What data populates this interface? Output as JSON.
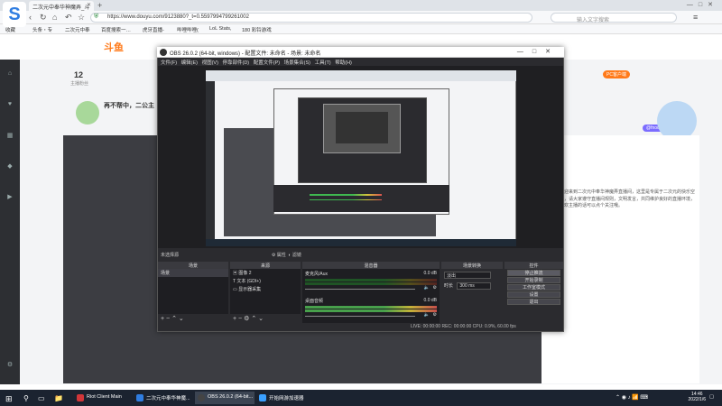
{
  "browser": {
    "tab_title": "二次元中奉华神魔弄_斗",
    "url": "https://www.douyu.com/9123880?_t=0.5597994799261002",
    "search_placeholder": "输入文字搜索",
    "bookmarks": [
      "收藏",
      "头条・专",
      "二次元中奉",
      "百度搜索一…",
      "虎牙直播-",
      "哔哩哔哩(",
      "LoL Stats,",
      "180 彩铃游戏"
    ]
  },
  "douyu": {
    "logo": "斗鱼",
    "count": "12",
    "count_label": "主播粉丝",
    "host_text": "再不帮中，二公主",
    "pc_badge": "PC客户端",
    "pub_tag": "@fnook",
    "right_text": "欢迎来到二次元中奉华神魔弄直播间，这里是专属于二次元的快乐空间，请大家遵守直播间规则，文明发言，共同维护良好的直播环境，喜欢主播的话可以点个关注哦。"
  },
  "obs": {
    "title": "OBS 26.0.2 (64-bit, windows) - 配置文件: 未命名 - 场景: 未命名",
    "menu": [
      "文件(F)",
      "编辑(E)",
      "视图(V)",
      "停靠部件(D)",
      "配置文件(P)",
      "场景集合(S)",
      "工具(T)",
      "帮助(H)"
    ],
    "scene_label": "未选择源",
    "tool_labels": [
      "属性",
      "滤镜"
    ],
    "docks": {
      "scenes": {
        "title": "场景",
        "items": [
          "场景"
        ]
      },
      "sources": {
        "title": "来源",
        "items": [
          "图像 2",
          "文本 (GDI+)",
          "显示器采集"
        ]
      },
      "mixer": {
        "title": "混音器",
        "tracks": [
          {
            "name": "麦克风/Aux",
            "db": "0.0 dB"
          },
          {
            "name": "桌面音频",
            "db": "0.0 dB"
          }
        ]
      },
      "transitions": {
        "title": "场景转换",
        "type": "淡出",
        "duration_label": "时长",
        "duration": "300 ms"
      },
      "controls": {
        "title": "控件",
        "buttons": [
          "停止推流",
          "开始录制",
          "工作室模式",
          "设置",
          "退出"
        ]
      }
    },
    "status": "LIVE: 00:00:00    REC: 00:00:00    CPU: 0.9%, 60.00 fps"
  },
  "taskbar": {
    "apps": [
      {
        "label": "Riot Client Main",
        "color": "#d13639"
      },
      {
        "label": "二次元中奉华神魔...",
        "color": "#2f7de1"
      },
      {
        "label": "OBS 26.0.2 (64-bit...",
        "color": "#444444"
      },
      {
        "label": "开始网游加速器",
        "color": "#3aa0ff"
      }
    ],
    "time": "14:46",
    "date": "2022/1/6"
  }
}
